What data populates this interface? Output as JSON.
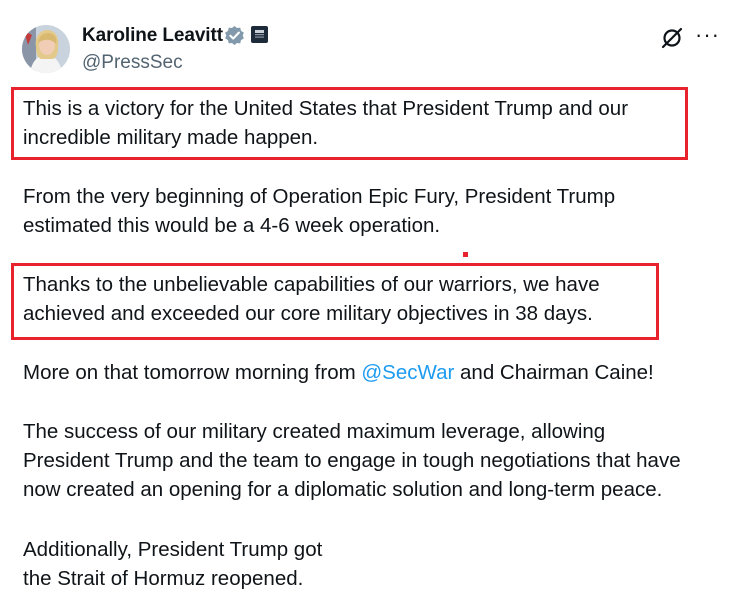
{
  "author": {
    "name": "Karoline Leavitt",
    "handle": "@PressSec",
    "verified": true,
    "avatar": "avatar-photo"
  },
  "actions": {
    "grok_icon": "grok-icon",
    "more_label": "···"
  },
  "post": {
    "p1_line1": "This is a victory for the United States that President Trump and our",
    "p1_line2": "incredible military made happen.",
    "p2_line1": "From the very beginning of Operation Epic Fury, President Trump",
    "p2_line2": "estimated this would be a 4-6 week operation.",
    "p3_line1": "Thanks to the unbelievable capabilities of our warriors, we have",
    "p3_line2": "achieved and exceeded our core military objectives in 38 days.",
    "p4_before": "More on that tomorrow morning from ",
    "p4_mention": "@SecWar",
    "p4_after": " and Chairman Caine!",
    "p5_line1": "The success of our military created maximum leverage, allowing",
    "p5_line2": "President Trump and the team to engage in tough negotiations that have",
    "p5_line3": "now created an opening for a diplomatic solution and long-term peace.",
    "p6_line1": "Additionally, President Trump got",
    "p6_line2": "the Strait of Hormuz reopened."
  },
  "colors": {
    "highlight": "#e8232d",
    "link": "#1d9bf0",
    "verified": "#829aab"
  }
}
